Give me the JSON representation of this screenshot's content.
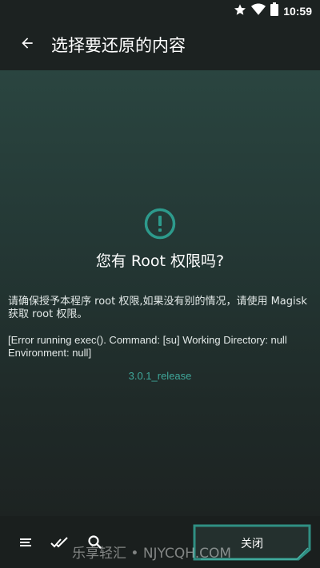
{
  "status_bar": {
    "time": "10:59",
    "icons": [
      "star-icon",
      "wifi-icon",
      "battery-icon"
    ]
  },
  "app_bar": {
    "title": "选择要还原的内容",
    "back_icon": "arrow-back-icon"
  },
  "dialog": {
    "icon": "alert-circle-icon",
    "question": "您有 Root 权限吗?",
    "description": "请确保授予本程序 root 权限,如果没有别的情况，请使用 Magisk 获取 root 权限。",
    "error": "[Error running exec(). Command: [su] Working Directory: null Environment: null]",
    "version": "3.0.1_release"
  },
  "bottom_bar": {
    "icons": [
      "sort-icon",
      "select-all-icon",
      "search-icon"
    ],
    "close_label": "关闭"
  },
  "watermark": "乐享轻汇 • NJYCQH.COM",
  "colors": {
    "accent": "#3fa79a",
    "background": "#1d2221",
    "icon_ring": "#2d9a8c"
  }
}
